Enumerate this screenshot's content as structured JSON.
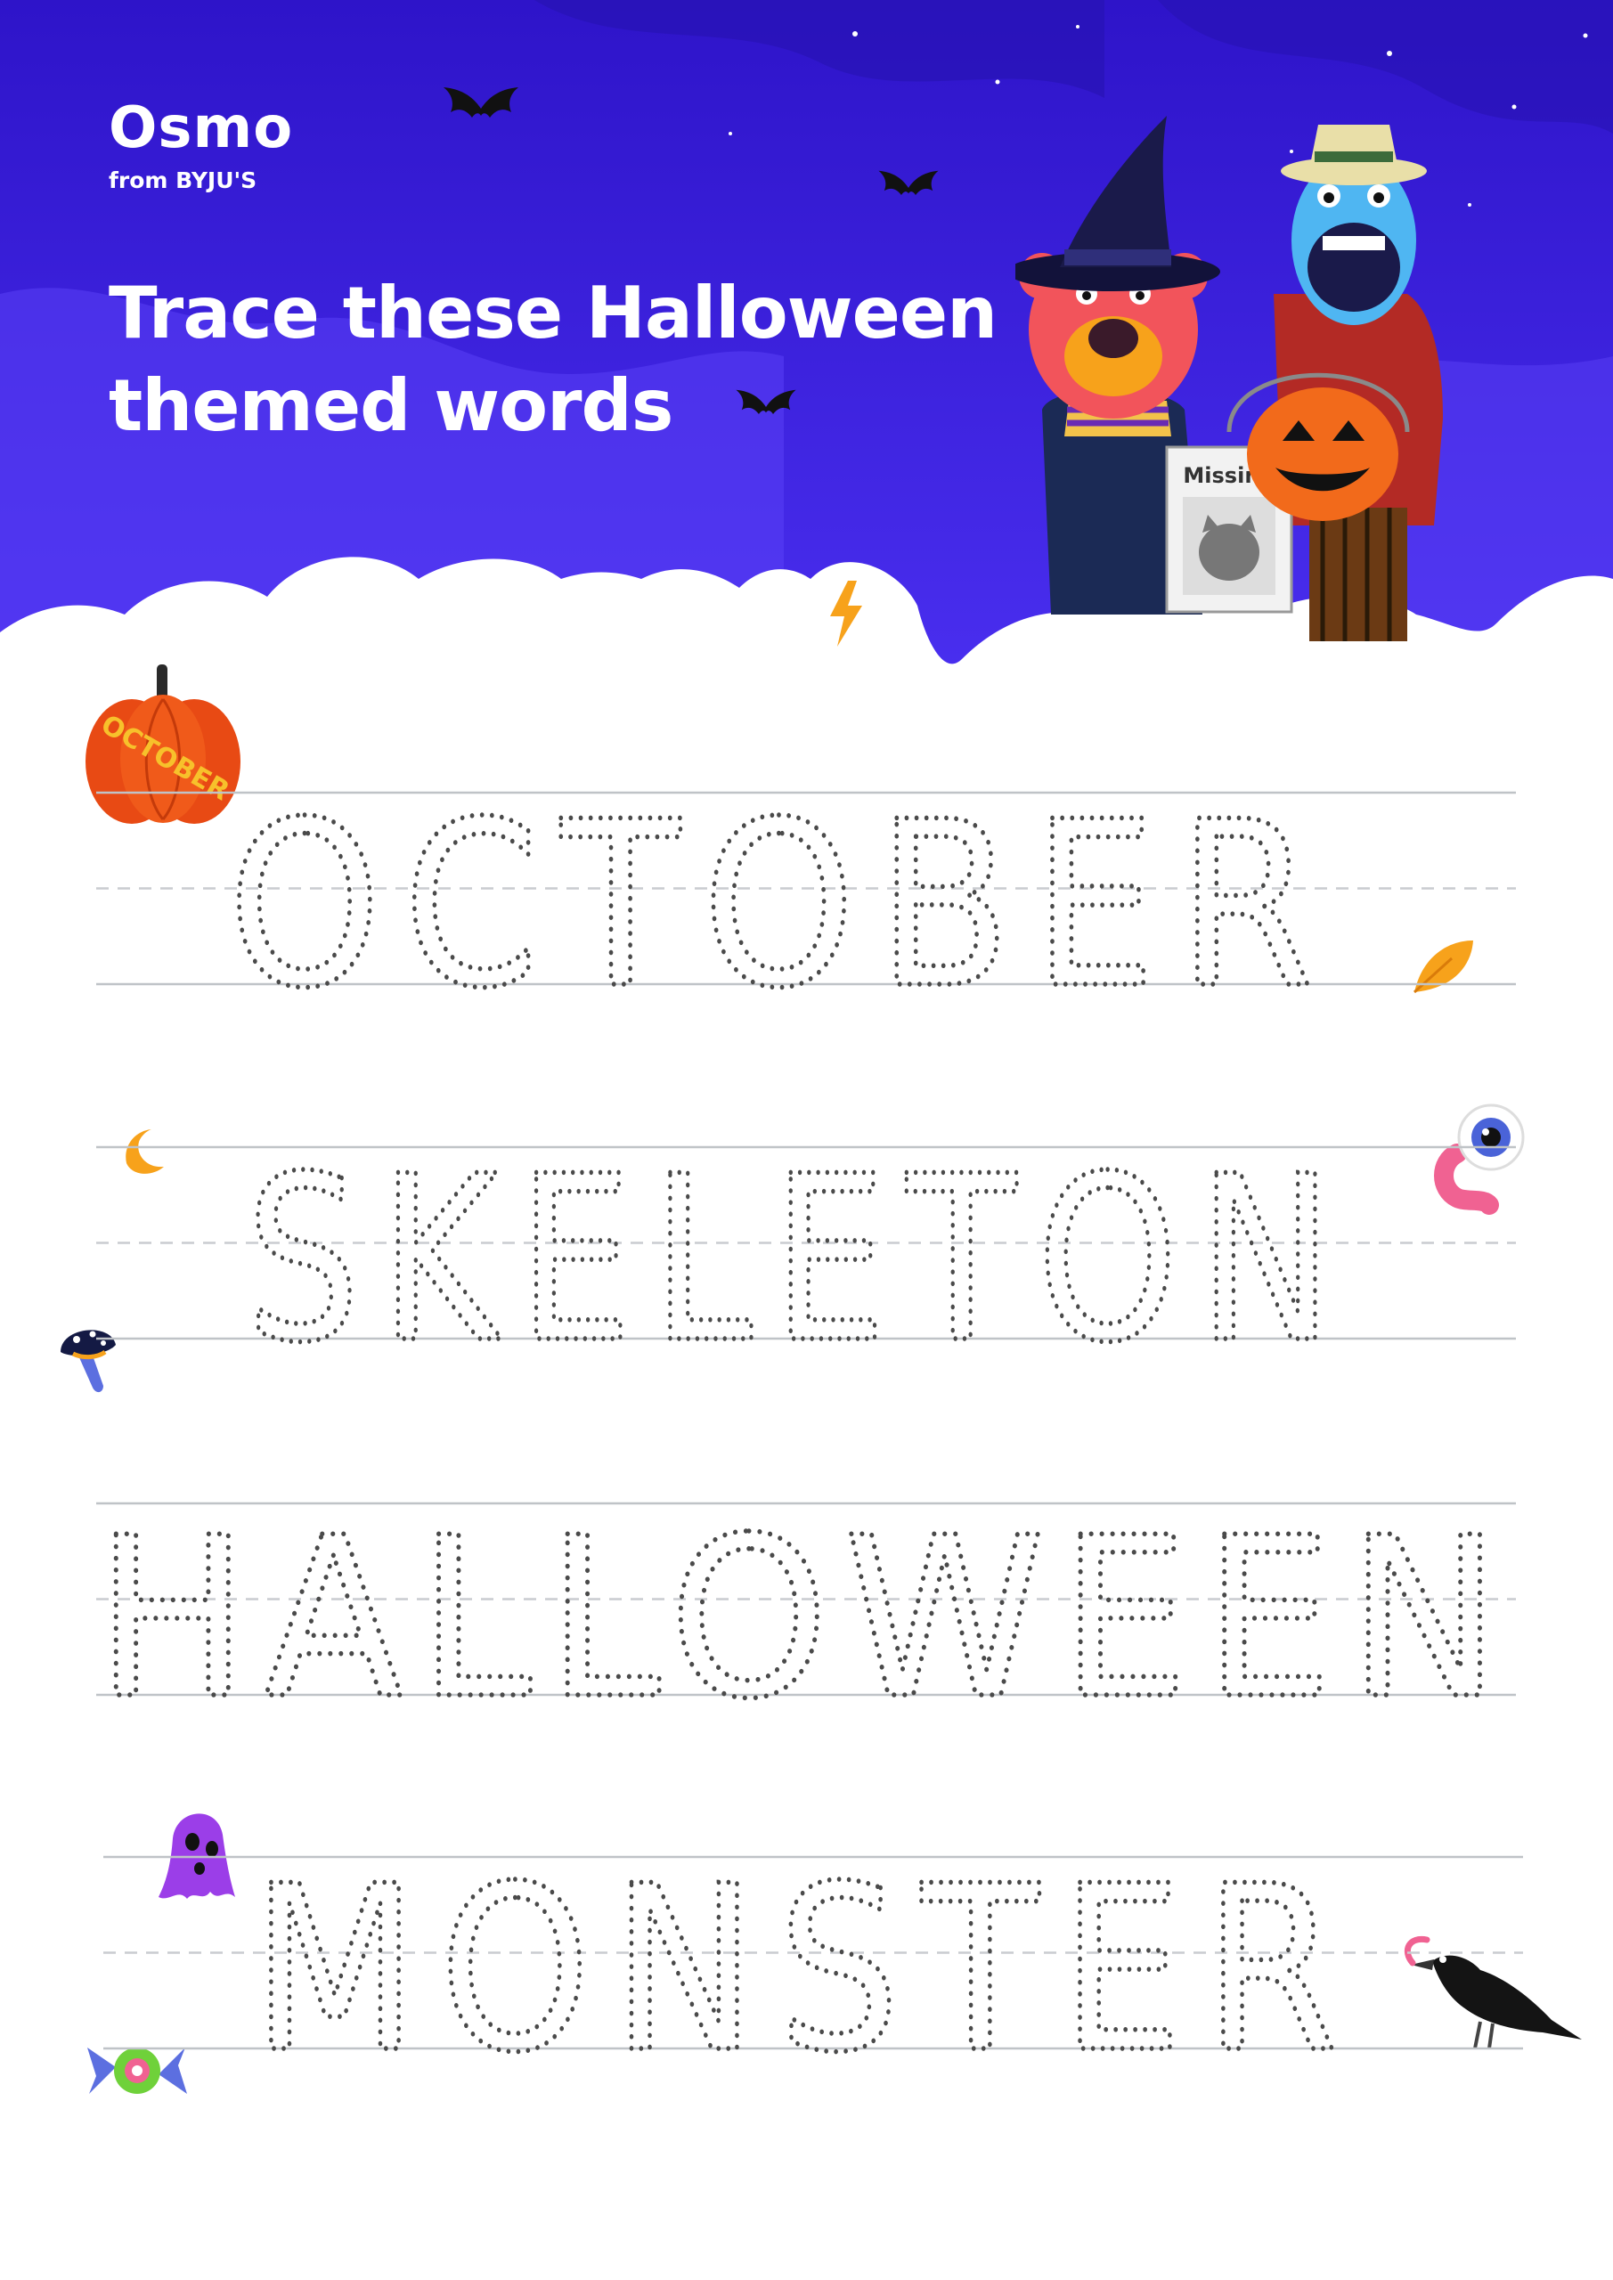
{
  "brand": {
    "name": "Osmo",
    "sub": "from BYJU'S"
  },
  "title": {
    "line1": "Trace these Halloween",
    "line2": "themed words"
  },
  "sign": {
    "label": "Missing"
  },
  "pumpkin": {
    "label": "OCTOBER"
  },
  "words": [
    "OCTOBER",
    "SKELETON",
    "HALLOWEEN",
    "MONSTER"
  ],
  "colors": {
    "sky": "#3b1fe8",
    "sky_dark": "#2a12b8",
    "rule_solid": "#bfc3c7",
    "rule_dash": "#c9ccd0",
    "dots": "#4a4a4a",
    "pumpkin": "#f05a1a",
    "accent_orange": "#f7a21b"
  }
}
